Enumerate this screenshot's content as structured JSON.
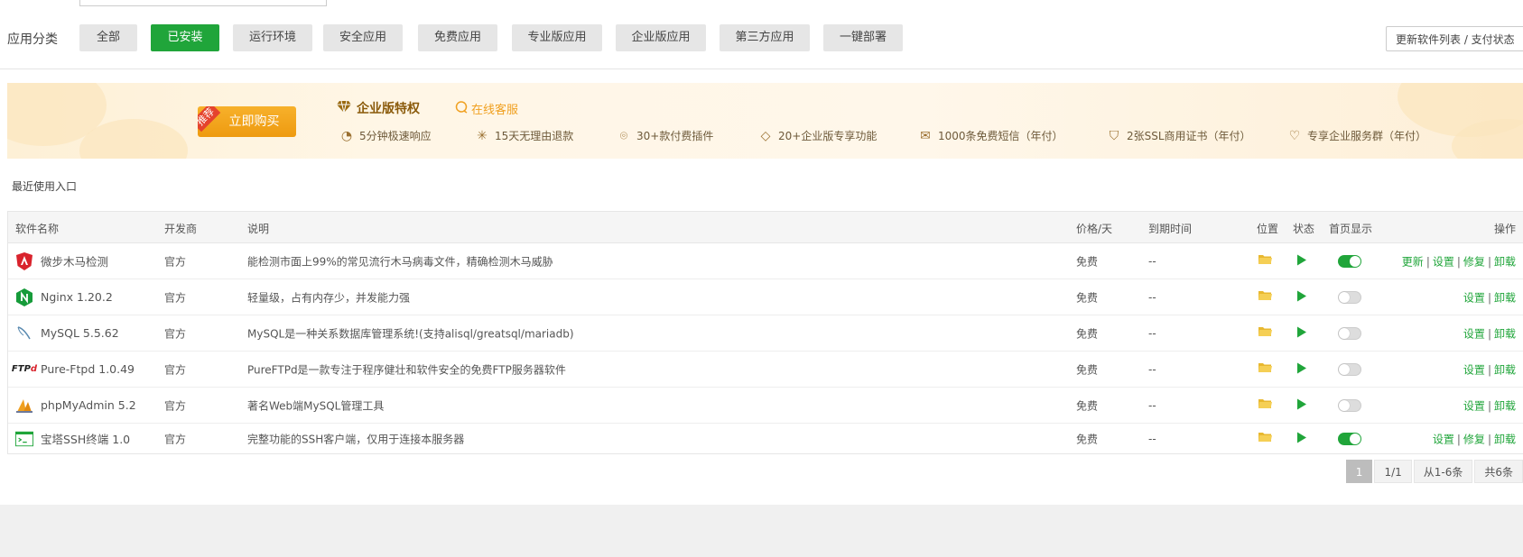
{
  "categories": {
    "label": "应用分类",
    "items": [
      "全部",
      "已安装",
      "运行环境",
      "安全应用",
      "免费应用",
      "专业版应用",
      "企业版应用",
      "第三方应用",
      "一键部署"
    ],
    "active_index": 1
  },
  "update_button": "更新软件列表 / 支付状态",
  "banner": {
    "tag": "推荐",
    "buy_label": "立即购买",
    "enterprise_title": "企业版特权",
    "service_label": "在线客服",
    "features": [
      {
        "icon": "clock-icon",
        "label": "5分钟极速响应"
      },
      {
        "icon": "refund-icon",
        "label": "15天无理由退款"
      },
      {
        "icon": "plugin-icon",
        "label": "30+款付费插件"
      },
      {
        "icon": "diamond-icon",
        "label": "20+企业版专享功能"
      },
      {
        "icon": "mail-icon",
        "label": "1000条免费短信（年付）"
      },
      {
        "icon": "ssl-icon",
        "label": "2张SSL商用证书（年付）"
      },
      {
        "icon": "heart-icon",
        "label": "专享企业服务群（年付）"
      }
    ]
  },
  "recent_label": "最近使用入口",
  "table": {
    "headers": {
      "name": "软件名称",
      "dev": "开发商",
      "desc": "说明",
      "price": "价格/天",
      "expire": "到期时间",
      "location": "位置",
      "status": "状态",
      "home": "首页显示",
      "ops": "操作"
    },
    "rows": [
      {
        "icon": "shield-icon",
        "name": "微步木马检测",
        "dev": "官方",
        "desc": "能检测市面上99%的常见流行木马病毒文件，精确检测木马威胁",
        "price": "免费",
        "expire": "--",
        "home_on": true,
        "ops": [
          "更新",
          "设置",
          "修复",
          "卸载"
        ]
      },
      {
        "icon": "nginx-icon",
        "name": "Nginx 1.20.2",
        "dev": "官方",
        "desc": "轻量级，占有内存少，并发能力强",
        "price": "免费",
        "expire": "--",
        "home_on": false,
        "ops": [
          "设置",
          "卸载"
        ]
      },
      {
        "icon": "mysql-icon",
        "name": "MySQL 5.5.62",
        "dev": "官方",
        "desc": "MySQL是一种关系数据库管理系统!(支持alisql/greatsql/mariadb)",
        "price": "免费",
        "expire": "--",
        "home_on": false,
        "ops": [
          "设置",
          "卸载"
        ]
      },
      {
        "icon": "ftp-icon",
        "name": "Pure-Ftpd 1.0.49",
        "dev": "官方",
        "desc": "PureFTPd是一款专注于程序健壮和软件安全的免费FTP服务器软件",
        "price": "免费",
        "expire": "--",
        "home_on": false,
        "ops": [
          "设置",
          "卸载"
        ]
      },
      {
        "icon": "phpmyadmin-icon",
        "name": "phpMyAdmin 5.2",
        "dev": "官方",
        "desc": "著名Web端MySQL管理工具",
        "price": "免费",
        "expire": "--",
        "home_on": false,
        "ops": [
          "设置",
          "卸载"
        ]
      },
      {
        "icon": "terminal-icon",
        "name": "宝塔SSH终端 1.0",
        "dev": "官方",
        "desc": "完整功能的SSH客户端，仅用于连接本服务器",
        "price": "免费",
        "expire": "--",
        "home_on": true,
        "ops": [
          "设置",
          "修复",
          "卸载"
        ]
      }
    ]
  },
  "pagination": {
    "current": "1",
    "pages": "1/1",
    "range": "从1-6条",
    "total": "共6条"
  },
  "colors": {
    "accent": "#20a53a",
    "banner_button": "#f0a21a",
    "icon_red": "#d9232d",
    "folder": "#f0c040"
  }
}
